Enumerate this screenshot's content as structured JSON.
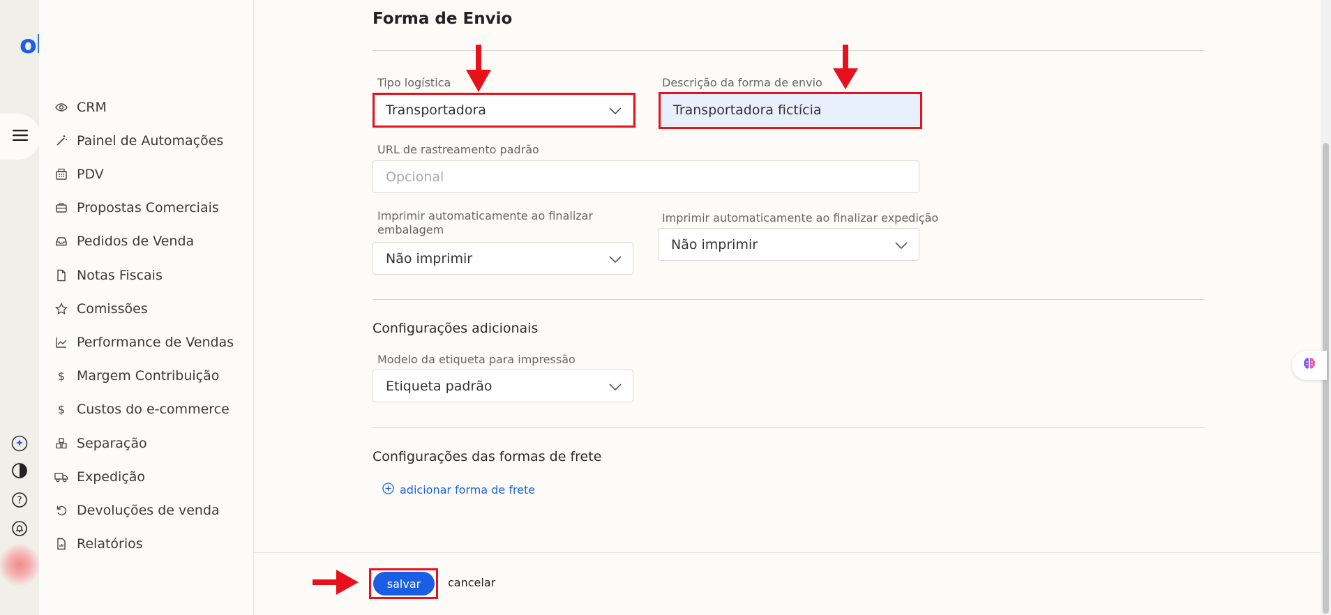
{
  "brand": {
    "logo_text": "olist",
    "accent_color": "#1d5fe6"
  },
  "sidebar": {
    "items": [
      {
        "label": "CRM",
        "icon": "eye-icon"
      },
      {
        "label": "Painel de Automações",
        "icon": "magic-wand-icon"
      },
      {
        "label": "PDV",
        "icon": "register-icon"
      },
      {
        "label": "Propostas Comerciais",
        "icon": "briefcase-icon"
      },
      {
        "label": "Pedidos de Venda",
        "icon": "inbox-icon"
      },
      {
        "label": "Notas Fiscais",
        "icon": "document-icon"
      },
      {
        "label": "Comissões",
        "icon": "star-icon"
      },
      {
        "label": "Performance de Vendas",
        "icon": "chart-line-icon"
      },
      {
        "label": "Margem Contribuição",
        "icon": "dollar-icon"
      },
      {
        "label": "Custos do e-commerce",
        "icon": "dollar-icon"
      },
      {
        "label": "Separação",
        "icon": "boxes-icon"
      },
      {
        "label": "Expedição",
        "icon": "truck-icon"
      },
      {
        "label": "Devoluções de venda",
        "icon": "undo-icon"
      },
      {
        "label": "Relatórios",
        "icon": "report-icon"
      }
    ]
  },
  "form": {
    "section_title": "Forma de Envio",
    "tipo_logistica": {
      "label": "Tipo logística",
      "value": "Transportadora"
    },
    "descricao": {
      "label": "Descrição da forma de envio",
      "value": "Transportadora fictícia"
    },
    "url_rastreamento": {
      "label": "URL de rastreamento padrão",
      "placeholder": "Opcional"
    },
    "imprimir_embalagem": {
      "label": "Imprimir automaticamente ao finalizar embalagem",
      "value": "Não imprimir"
    },
    "imprimir_expedicao": {
      "label": "Imprimir automaticamente ao finalizar expedição",
      "value": "Não imprimir"
    },
    "config_adicionais": {
      "title": "Configurações adicionais",
      "modelo_etiqueta": {
        "label": "Modelo da etiqueta para impressão",
        "value": "Etiqueta padrão"
      }
    },
    "config_frete": {
      "title": "Configurações das formas de frete",
      "add_label": "adicionar forma de frete"
    }
  },
  "footer": {
    "save_label": "salvar",
    "cancel_label": "cancelar"
  },
  "annotation_color": "#e8101b"
}
